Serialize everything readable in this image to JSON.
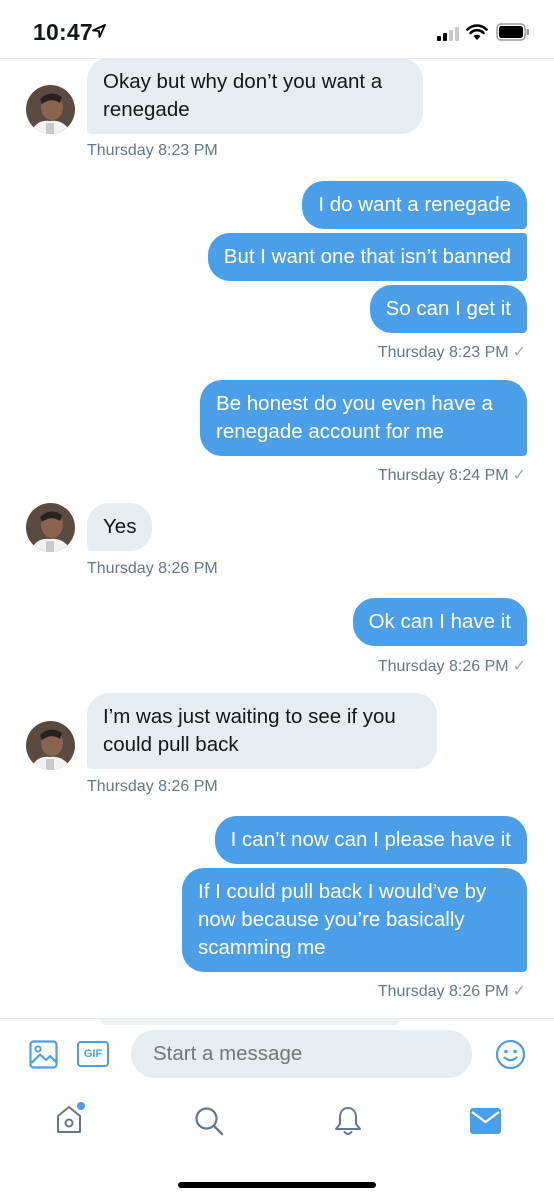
{
  "status_bar": {
    "time": "10:47"
  },
  "conversation": {
    "messages": [
      {
        "dir": "in",
        "text": "Okay but why don’t you want a renegade"
      },
      {
        "dir": "in",
        "timestamp": "Thursday 8:23 PM"
      },
      {
        "dir": "out",
        "text": "I do want a renegade"
      },
      {
        "dir": "out",
        "text": "But I want one that isn’t banned"
      },
      {
        "dir": "out",
        "text": "So can I get it"
      },
      {
        "dir": "out",
        "timestamp": "Thursday 8:23 PM"
      },
      {
        "dir": "out",
        "text": "Be honest do you even have a renegade account for me"
      },
      {
        "dir": "out",
        "timestamp": "Thursday 8:24 PM"
      },
      {
        "dir": "in",
        "text": "Yes"
      },
      {
        "dir": "in",
        "timestamp": "Thursday 8:26 PM"
      },
      {
        "dir": "out",
        "text": "Ok can I have it"
      },
      {
        "dir": "out",
        "timestamp": "Thursday 8:26 PM"
      },
      {
        "dir": "in",
        "text": "I’m was just waiting to see if you could pull back"
      },
      {
        "dir": "in",
        "timestamp": "Thursday 8:26 PM"
      },
      {
        "dir": "out",
        "text": "I can’t now can I please have it"
      },
      {
        "dir": "out",
        "text": "If I could pull back I would’ve by now because you’re basically scamming me"
      },
      {
        "dir": "out",
        "timestamp": "Thursday 8:26 PM"
      }
    ],
    "read_mark": "✓"
  },
  "composer": {
    "placeholder": "Start a message",
    "gif_label": "GIF"
  },
  "tab_bar": {
    "icons": [
      "home-icon",
      "search-icon",
      "notifications-icon",
      "messages-icon"
    ],
    "active": "messages-icon",
    "accent": "#4a9fe8"
  },
  "colors": {
    "outgoing_bubble": "#4a9fe8",
    "incoming_bubble": "#e6ecf0",
    "timestamp": "#657786"
  }
}
